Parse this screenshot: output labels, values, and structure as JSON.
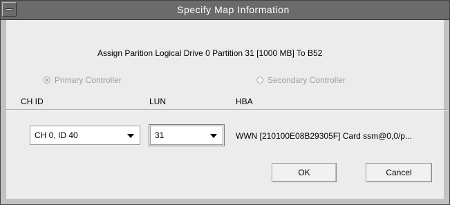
{
  "window": {
    "title": "Specify Map Information"
  },
  "assign_text": "Assign Parition Logical Drive 0 Partition 31 [1000 MB]  To B52",
  "radios": {
    "primary": {
      "label": "Primary Controller",
      "checked": true,
      "enabled": false
    },
    "secondary": {
      "label": "Secondary Controller",
      "checked": false,
      "enabled": false
    }
  },
  "columns": {
    "ch_id": "CH ID",
    "lun": "LUN",
    "hba": "HBA"
  },
  "row": {
    "ch_id_selected": "CH 0, ID 40",
    "lun_selected": "31",
    "hba_value": "WWN [210100E08B29305F] Card ssm@0,0/p..."
  },
  "buttons": {
    "ok": "OK",
    "cancel": "Cancel"
  }
}
